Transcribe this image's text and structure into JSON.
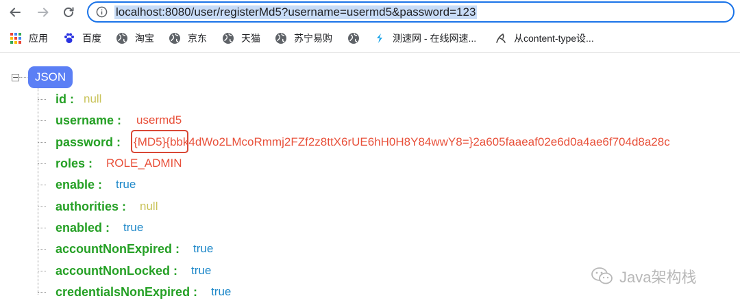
{
  "browser": {
    "url": "localhost:8080/user/registerMd5?username=usermd5&password=123"
  },
  "bookmarks": [
    {
      "label": "应用",
      "icon": "apps-grid-icon"
    },
    {
      "label": "百度",
      "icon": "baidu-paw-icon"
    },
    {
      "label": "淘宝",
      "icon": "globe-icon"
    },
    {
      "label": "京东",
      "icon": "globe-icon"
    },
    {
      "label": "天猫",
      "icon": "globe-icon"
    },
    {
      "label": "苏宁易购",
      "icon": "globe-icon"
    },
    {
      "label": "",
      "icon": "globe-icon"
    },
    {
      "label": "测速网 - 在线网速...",
      "icon": "speedtest-icon"
    },
    {
      "label": "从content-type设...",
      "icon": "page-icon"
    }
  ],
  "json_viewer": {
    "root_label": "JSON",
    "toggle_symbol": "−",
    "fields": [
      {
        "key": "id :",
        "value": "null",
        "type": "null"
      },
      {
        "key": "username :",
        "value": "usermd5",
        "type": "string"
      },
      {
        "key": "password :",
        "value": "{MD5}{bbk4dWo2LMcoRmmj2FZf2z8ttX6rUE6hH0H8Y84wwY8=}2a605faaeaf02e6d0a4ae6f704d8a28c",
        "type": "string"
      },
      {
        "key": "roles :",
        "value": "ROLE_ADMIN",
        "type": "string"
      },
      {
        "key": "enable :",
        "value": "true",
        "type": "bool"
      },
      {
        "key": "authorities :",
        "value": "null",
        "type": "null"
      },
      {
        "key": "enabled :",
        "value": "true",
        "type": "bool"
      },
      {
        "key": "accountNonExpired :",
        "value": "true",
        "type": "bool"
      },
      {
        "key": "accountNonLocked :",
        "value": "true",
        "type": "bool"
      },
      {
        "key": "credentialsNonExpired :",
        "value": "true",
        "type": "bool"
      }
    ]
  },
  "watermark": {
    "text": "Java架构栈"
  },
  "colors": {
    "key": "#25a025",
    "null": "#c9c35a",
    "string": "#e8503a",
    "bool": "#1e88c9",
    "badge": "#5b7ff5",
    "highlight_box": "#d94735",
    "address_border": "#1a73e8"
  }
}
